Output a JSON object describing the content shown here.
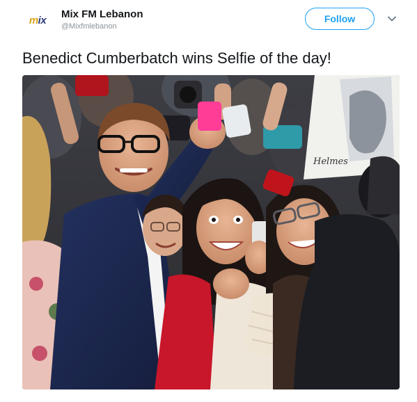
{
  "tweet": {
    "display_name": "Mix FM Lebanon",
    "handle": "@Mixfmlebanon",
    "follow_label": "Follow",
    "text": "Benedict Cumberbatch wins Selfie of the day!",
    "avatar": {
      "logo_text_accent": "m",
      "logo_text": "ix"
    },
    "photo": {
      "sign_text": "Helmes"
    }
  },
  "colors": {
    "accent": "#1da1f2",
    "text": "#14171a",
    "secondary": "#8a9399"
  },
  "icons": {
    "menu": "chevron-down-icon"
  }
}
